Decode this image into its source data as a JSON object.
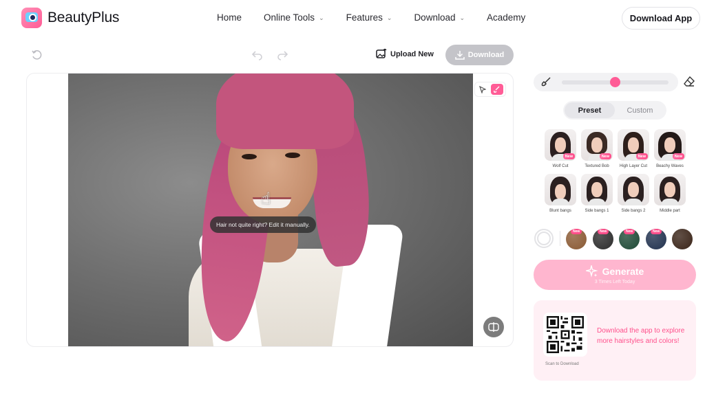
{
  "header": {
    "brand": "BeautyPlus",
    "nav": [
      {
        "label": "Home",
        "dropdown": false
      },
      {
        "label": "Online Tools",
        "dropdown": true
      },
      {
        "label": "Features",
        "dropdown": true
      },
      {
        "label": "Download",
        "dropdown": true
      },
      {
        "label": "Academy",
        "dropdown": false
      }
    ],
    "download_app": "Download App"
  },
  "toolbar": {
    "upload_new": "Upload New",
    "download": "Download"
  },
  "canvas": {
    "tooltip": "Hair not quite right? Edit it manually."
  },
  "panel": {
    "brush_size_fraction": 0.5,
    "tabs": [
      {
        "label": "Preset",
        "active": true
      },
      {
        "label": "Custom",
        "active": false
      }
    ],
    "styles": [
      {
        "label": "Wolf Cut",
        "new": true
      },
      {
        "label": "Textured Bob",
        "new": true
      },
      {
        "label": "High Layer Cut",
        "new": true
      },
      {
        "label": "Beachy Waves",
        "new": true
      },
      {
        "label": "Blunt bangs",
        "new": false
      },
      {
        "label": "Side bangs 1",
        "new": false
      },
      {
        "label": "Side bangs 2",
        "new": false
      },
      {
        "label": "Middle part",
        "new": false
      }
    ],
    "color_new_badge": "New",
    "colors": [
      "#8a5a34",
      "#2c2c2c",
      "#1f4a36",
      "#22324f",
      "#3a2418"
    ],
    "generate": {
      "label": "Generate",
      "sub": "3 Times Left Today"
    },
    "promo": {
      "scan": "Scan to Download",
      "text": "Download the app to explore more hairstyles and colors!"
    }
  },
  "accent_color": "#ff5c96"
}
